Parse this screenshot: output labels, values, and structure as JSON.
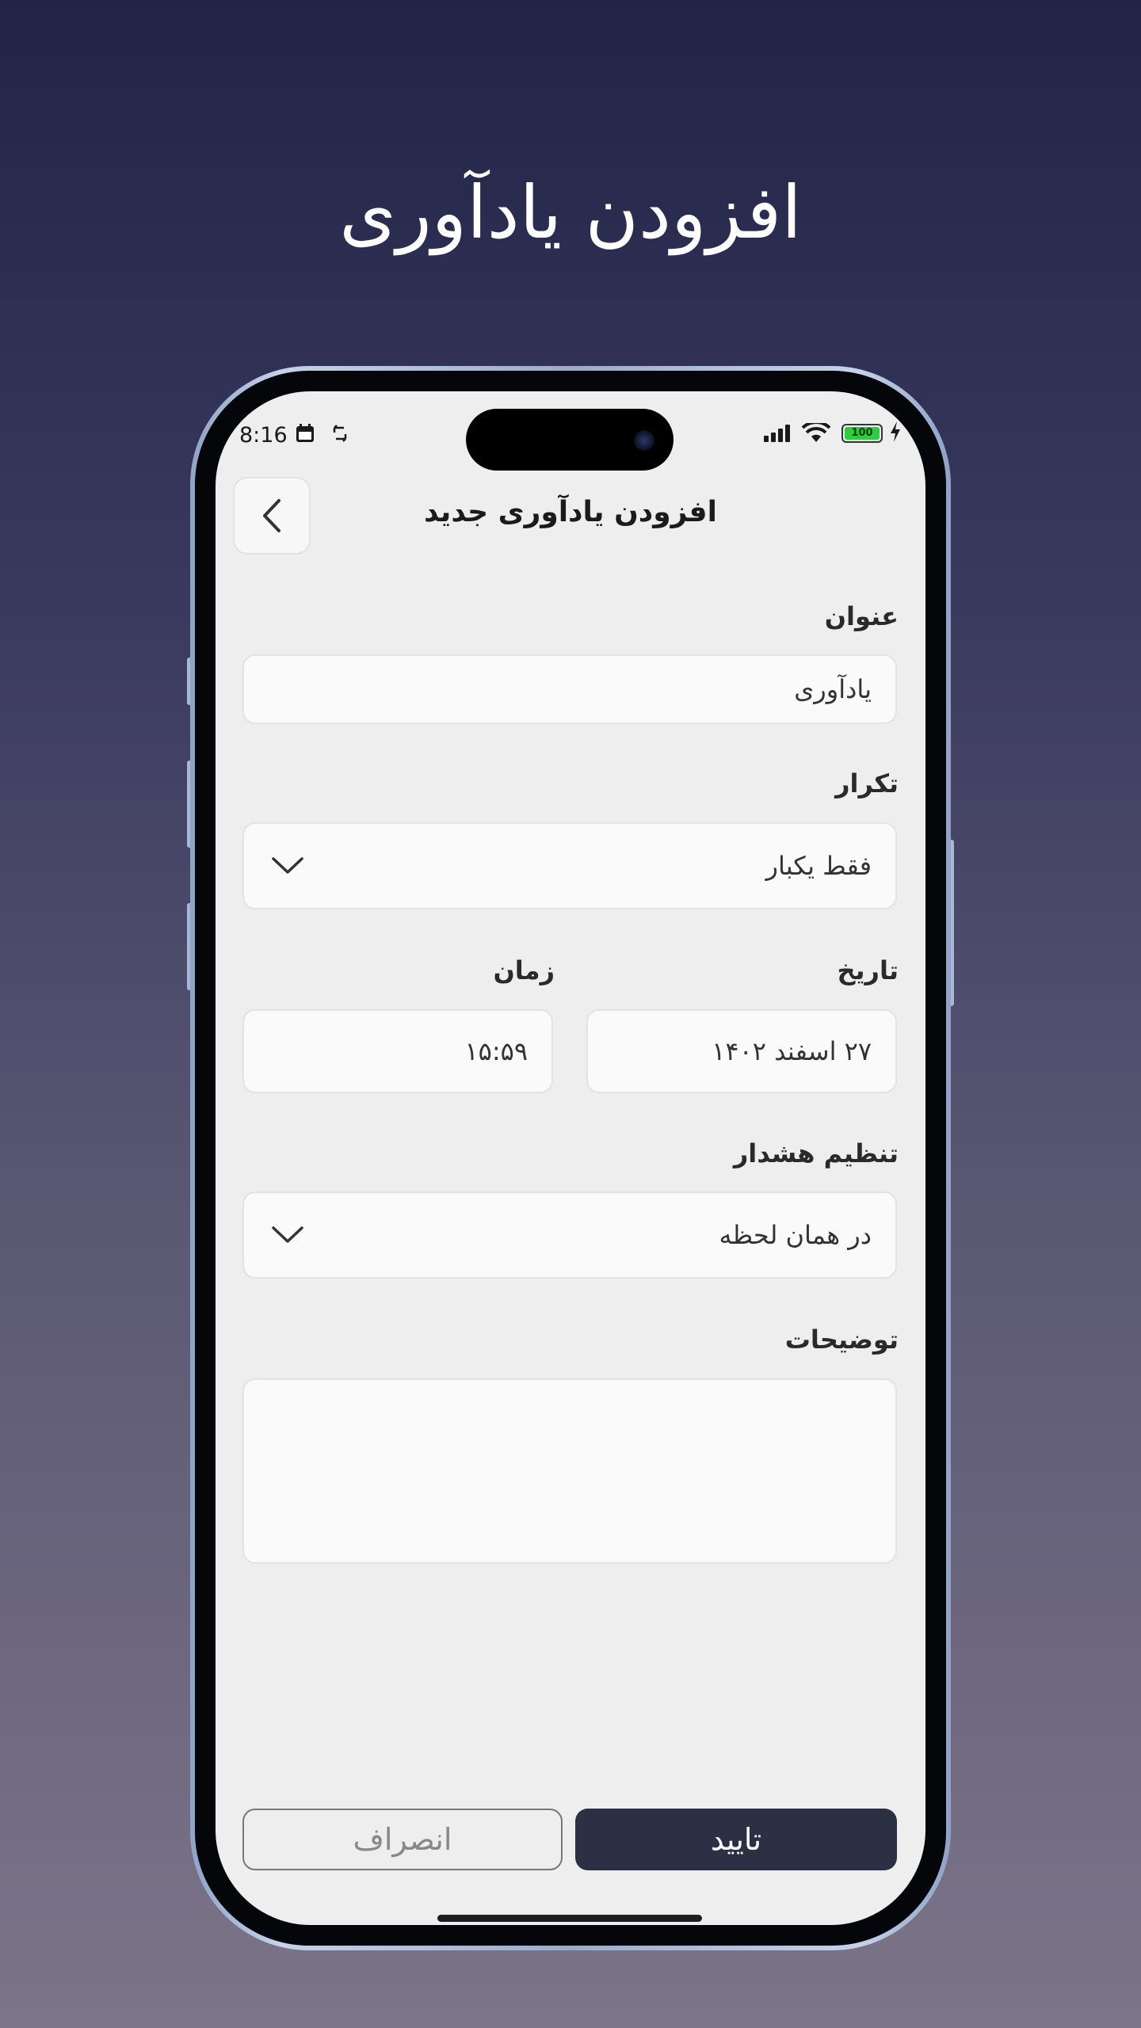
{
  "hero": {
    "title": "افزودن یادآوری"
  },
  "status_bar": {
    "time": "8:16",
    "battery": "100"
  },
  "header": {
    "title": "افزودن یادآوری جدید"
  },
  "form": {
    "title_label": "عنوان",
    "title_value": "یادآوری",
    "repeat_label": "تکرار",
    "repeat_value": "فقط یکبار",
    "date_label": "تاریخ",
    "date_value": "۲۷ اسفند ۱۴۰۲",
    "time_label": "زمان",
    "time_value": "۱۵:۵۹",
    "alarm_label": "تنظیم هشدار",
    "alarm_value": "در همان لحظه",
    "notes_label": "توضیحات",
    "notes_value": ""
  },
  "actions": {
    "confirm": "تایید",
    "cancel": "انصراف"
  },
  "colors": {
    "primary": "#2b3045",
    "background": "#eeeeee"
  }
}
